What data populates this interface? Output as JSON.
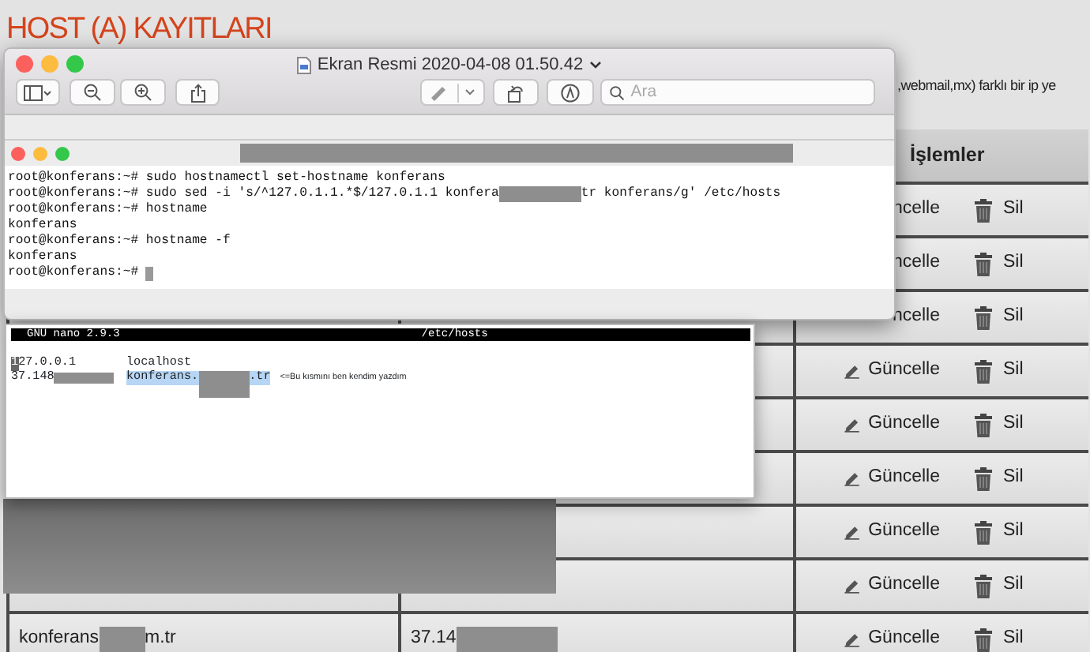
{
  "page": {
    "title": "HOST (A) KAYITLARI",
    "intro_fragment": ",webmail,mx) farklı bir ip ye"
  },
  "table": {
    "action_header": "İşlemler",
    "rows": [
      {
        "kind": "covered",
        "edit_label": "ncelle",
        "delete_label": "Sil"
      },
      {
        "kind": "covered",
        "edit_label": "ncelle",
        "delete_label": "Sil"
      },
      {
        "kind": "covered",
        "edit_label": "ncelle",
        "delete_label": "Sil"
      },
      {
        "kind": "full",
        "edit_label": "Güncelle",
        "delete_label": "Sil"
      },
      {
        "kind": "full",
        "edit_label": "Güncelle",
        "delete_label": "Sil"
      },
      {
        "kind": "full",
        "edit_label": "Güncelle",
        "delete_label": "Sil"
      },
      {
        "kind": "full",
        "edit_label": "Güncelle",
        "delete_label": "Sil"
      },
      {
        "kind": "full",
        "edit_label": "Güncelle",
        "delete_label": "Sil"
      },
      {
        "kind": "full",
        "edit_label": "Güncelle",
        "delete_label": "Sil",
        "host_prefix": "konferans",
        "host_suffix": "m.tr",
        "ip_prefix": "37.14"
      }
    ]
  },
  "preview_window": {
    "title": "Ekran Resmi 2020-04-08 01.50.42",
    "search": {
      "placeholder": "Ara"
    },
    "terminal": {
      "lines": [
        [
          {
            "kind": "text",
            "text": "root@konferans:~# sudo hostnamectl set-hostname konferans"
          }
        ],
        [
          {
            "kind": "text",
            "text": "root@konferans:~# sudo sed -i 's/^127.0.1.1.*$/127.0.1.1 konfera"
          },
          {
            "kind": "redaction"
          },
          {
            "kind": "text",
            "text": "tr konferans/g' /etc/hosts"
          }
        ],
        [
          {
            "kind": "text",
            "text": "root@konferans:~# hostname"
          }
        ],
        [
          {
            "kind": "text",
            "text": "konferans"
          }
        ],
        [
          {
            "kind": "text",
            "text": "root@konferans:~# hostname -f"
          }
        ],
        [
          {
            "kind": "text",
            "text": "konferans"
          }
        ],
        [
          {
            "kind": "text",
            "text": "root@konferans:~# "
          },
          {
            "kind": "cursor"
          }
        ]
      ]
    }
  },
  "nano": {
    "version": "GNU nano 2.9.3",
    "file": "/etc/hosts",
    "lines": [
      {
        "address": [
          {
            "kind": "cursor",
            "text": "1"
          },
          {
            "kind": "text",
            "text": "27.0.0.1"
          }
        ],
        "host": [
          {
            "kind": "text",
            "text": "localhost",
            "highlighted": false
          }
        ]
      },
      {
        "address": [
          {
            "kind": "text",
            "text": "37.148"
          },
          {
            "kind": "redaction"
          }
        ],
        "host": [
          {
            "kind": "text",
            "text": "konferans.",
            "highlighted": true
          },
          {
            "kind": "redaction"
          },
          {
            "kind": "text",
            "text": ".tr",
            "highlighted": true
          }
        ],
        "note": "<=Bu kısmını ben kendim yazdım"
      }
    ]
  }
}
